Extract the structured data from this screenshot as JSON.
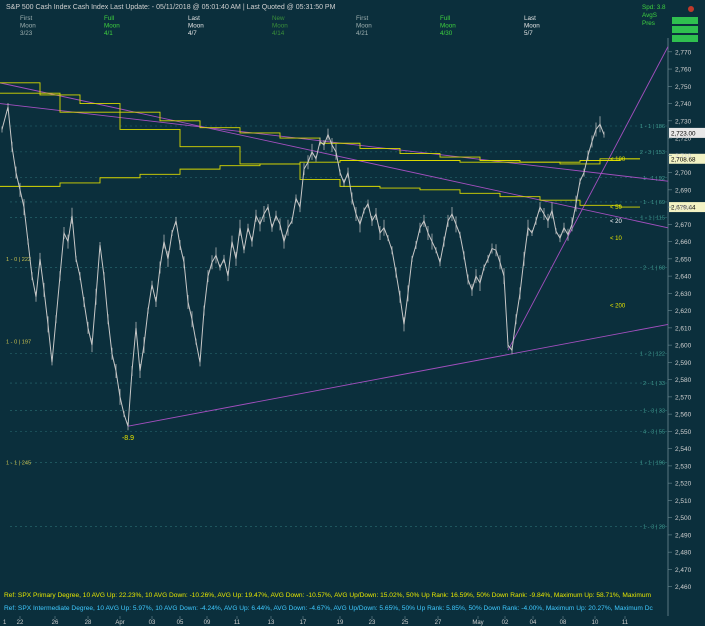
{
  "header": {
    "title": "S&P 500  Cash Index   Cash Index   Last Update: - 05/11/2018 @ 05:01:40 AM | Last Quoted @ 05:31:50 PM",
    "phases": [
      {
        "l1": "First",
        "l2": "Moon",
        "l3": "3/23",
        "c": "#9fb0b0"
      },
      {
        "l1": "Full",
        "l2": "Moon",
        "l3": "4/1",
        "c": "#3fd23f"
      },
      {
        "l1": "Last",
        "l2": "Moon",
        "l3": "4/7",
        "c": "#e6e6e6"
      },
      {
        "l1": "New",
        "l2": "Moon",
        "l3": "4/14",
        "c": "#3a8f3a"
      },
      {
        "l1": "First",
        "l2": "Moon",
        "l3": "4/21",
        "c": "#9fb0b0"
      },
      {
        "l1": "Full",
        "l2": "Moon",
        "l3": "4/30",
        "c": "#3fd23f"
      },
      {
        "l1": "Last",
        "l2": "Moon",
        "l3": "5/7",
        "c": "#e6e6e6"
      }
    ],
    "right_labels": [
      "Spd: 3.8",
      "AvgS",
      "Pres"
    ]
  },
  "chart_data": {
    "type": "line",
    "title": "S&P 500  Cash Index",
    "ylim": [
      2443,
      2778
    ],
    "y_ticks": [
      2460,
      2470,
      2480,
      2490,
      2500,
      2510,
      2520,
      2530,
      2540,
      2550,
      2560,
      2570,
      2580,
      2590,
      2600,
      2610,
      2620,
      2630,
      2640,
      2650,
      2660,
      2670,
      2680,
      2690,
      2700,
      2710,
      2720,
      2730,
      2740,
      2750,
      2760,
      2770
    ],
    "x_ticks": [
      "22",
      "26",
      "28",
      "Apr",
      "03",
      "05",
      "09",
      "11",
      "13",
      "17",
      "19",
      "23",
      "25",
      "27",
      "May",
      "02",
      "04",
      "08",
      "10",
      "11"
    ],
    "series": [
      {
        "color": "#c8c8c8",
        "points": [
          [
            2,
            2725
          ],
          [
            8,
            2738
          ],
          [
            12,
            2715
          ],
          [
            16,
            2700
          ],
          [
            20,
            2690
          ],
          [
            24,
            2680
          ],
          [
            28,
            2660
          ],
          [
            32,
            2640
          ],
          [
            36,
            2628
          ],
          [
            40,
            2650
          ],
          [
            44,
            2632
          ],
          [
            48,
            2612
          ],
          [
            52,
            2590
          ],
          [
            56,
            2615
          ],
          [
            60,
            2640
          ],
          [
            64,
            2665
          ],
          [
            68,
            2660
          ],
          [
            72,
            2675
          ],
          [
            76,
            2650
          ],
          [
            80,
            2640
          ],
          [
            84,
            2625
          ],
          [
            88,
            2610
          ],
          [
            92,
            2600
          ],
          [
            96,
            2628
          ],
          [
            100,
            2658
          ],
          [
            104,
            2640
          ],
          [
            108,
            2615
          ],
          [
            112,
            2595
          ],
          [
            116,
            2585
          ],
          [
            120,
            2570
          ],
          [
            124,
            2560
          ],
          [
            128,
            2553
          ],
          [
            132,
            2585
          ],
          [
            136,
            2610
          ],
          [
            140,
            2585
          ],
          [
            144,
            2600
          ],
          [
            148,
            2620
          ],
          [
            152,
            2635
          ],
          [
            156,
            2625
          ],
          [
            160,
            2645
          ],
          [
            164,
            2660
          ],
          [
            168,
            2650
          ],
          [
            172,
            2665
          ],
          [
            176,
            2672
          ],
          [
            180,
            2658
          ],
          [
            184,
            2648
          ],
          [
            188,
            2625
          ],
          [
            192,
            2615
          ],
          [
            196,
            2602
          ],
          [
            200,
            2590
          ],
          [
            204,
            2620
          ],
          [
            208,
            2640
          ],
          [
            212,
            2648
          ],
          [
            216,
            2652
          ],
          [
            220,
            2645
          ],
          [
            224,
            2650
          ],
          [
            228,
            2640
          ],
          [
            232,
            2660
          ],
          [
            236,
            2650
          ],
          [
            240,
            2668
          ],
          [
            244,
            2655
          ],
          [
            248,
            2668
          ],
          [
            252,
            2660
          ],
          [
            256,
            2675
          ],
          [
            260,
            2670
          ],
          [
            264,
            2676
          ],
          [
            268,
            2680
          ],
          [
            272,
            2668
          ],
          [
            276,
            2675
          ],
          [
            280,
            2670
          ],
          [
            284,
            2660
          ],
          [
            288,
            2668
          ],
          [
            292,
            2672
          ],
          [
            296,
            2685
          ],
          [
            300,
            2680
          ],
          [
            304,
            2702
          ],
          [
            308,
            2706
          ],
          [
            312,
            2712
          ],
          [
            316,
            2708
          ],
          [
            320,
            2718
          ],
          [
            324,
            2716
          ],
          [
            328,
            2722
          ],
          [
            332,
            2716
          ],
          [
            336,
            2712
          ],
          [
            340,
            2700
          ],
          [
            344,
            2694
          ],
          [
            348,
            2700
          ],
          [
            352,
            2685
          ],
          [
            356,
            2676
          ],
          [
            360,
            2670
          ],
          [
            364,
            2678
          ],
          [
            368,
            2682
          ],
          [
            372,
            2672
          ],
          [
            376,
            2676
          ],
          [
            380,
            2665
          ],
          [
            384,
            2668
          ],
          [
            388,
            2662
          ],
          [
            392,
            2655
          ],
          [
            396,
            2642
          ],
          [
            400,
            2628
          ],
          [
            404,
            2612
          ],
          [
            408,
            2630
          ],
          [
            412,
            2650
          ],
          [
            416,
            2658
          ],
          [
            420,
            2668
          ],
          [
            424,
            2672
          ],
          [
            428,
            2665
          ],
          [
            432,
            2660
          ],
          [
            436,
            2655
          ],
          [
            440,
            2648
          ],
          [
            444,
            2660
          ],
          [
            448,
            2672
          ],
          [
            452,
            2676
          ],
          [
            456,
            2670
          ],
          [
            460,
            2664
          ],
          [
            464,
            2652
          ],
          [
            468,
            2638
          ],
          [
            472,
            2632
          ],
          [
            476,
            2640
          ],
          [
            480,
            2636
          ],
          [
            484,
            2645
          ],
          [
            488,
            2650
          ],
          [
            492,
            2656
          ],
          [
            496,
            2655
          ],
          [
            500,
            2648
          ],
          [
            504,
            2640
          ],
          [
            508,
            2600
          ],
          [
            512,
            2597
          ],
          [
            516,
            2615
          ],
          [
            520,
            2630
          ],
          [
            524,
            2650
          ],
          [
            528,
            2668
          ],
          [
            532,
            2665
          ],
          [
            536,
            2672
          ],
          [
            540,
            2680
          ],
          [
            544,
            2676
          ],
          [
            548,
            2672
          ],
          [
            552,
            2678
          ],
          [
            556,
            2666
          ],
          [
            560,
            2662
          ],
          [
            564,
            2668
          ],
          [
            568,
            2664
          ],
          [
            572,
            2670
          ],
          [
            576,
            2682
          ],
          [
            580,
            2695
          ],
          [
            584,
            2700
          ],
          [
            588,
            2710
          ],
          [
            592,
            2718
          ],
          [
            596,
            2725
          ],
          [
            600,
            2728
          ],
          [
            604,
            2722
          ]
        ]
      }
    ],
    "wave_labels": [
      {
        "text": "-8.9",
        "day": 128,
        "y": 2545,
        "color": "#e6e600"
      }
    ]
  },
  "ma_labels": [
    {
      "text": "< 100",
      "y": 2708,
      "color": "#e6e600"
    },
    {
      "text": "< 50",
      "y": 2680,
      "color": "#e6e600"
    },
    {
      "text": "< 20",
      "y": 2672,
      "color": "#ffffff"
    },
    {
      "text": "< 10",
      "y": 2662,
      "color": "#e6e600"
    },
    {
      "text": "< 200",
      "y": 2623,
      "color": "#e6e600"
    }
  ],
  "price_boxes": [
    {
      "text": "2,723.00",
      "y": 2723,
      "bg": "#e8e8e8",
      "fg": "#000000"
    },
    {
      "text": "2,708.68",
      "y": 2708,
      "bg": "#f3f3c4",
      "fg": "#000000"
    },
    {
      "text": "2,679.44",
      "y": 2680,
      "bg": "#f3f3c4",
      "fg": "#000000"
    }
  ],
  "fib_labels": [
    {
      "text": "1 - 1 | 186",
      "y": 2727,
      "side": "right"
    },
    {
      "text": "2 - 3 | 153",
      "y": 2712,
      "side": "right"
    },
    {
      "text": "1 - 1 | 92",
      "y": 2697,
      "side": "right"
    },
    {
      "text": "1 - 1 | 69",
      "y": 2683,
      "side": "right"
    },
    {
      "text": "1 - 1 | 115",
      "y": 2674,
      "side": "right"
    },
    {
      "text": "2 - 1 | 68",
      "y": 2645,
      "side": "right"
    },
    {
      "text": "1 - 2 | 122",
      "y": 2595,
      "side": "right"
    },
    {
      "text": "2 - 1 | 33",
      "y": 2578,
      "side": "right"
    },
    {
      "text": "1 - 3 | 33",
      "y": 2562,
      "side": "right"
    },
    {
      "text": "4 - 3 | 55",
      "y": 2550,
      "side": "right"
    },
    {
      "text": "1 - 1 | 196",
      "y": 2532,
      "side": "right"
    },
    {
      "text": "1 - 3 | 28",
      "y": 2495,
      "side": "right"
    },
    {
      "text": "1 - 0 | 222",
      "y": 2650,
      "side": "left"
    },
    {
      "text": "1 - 0 | 197",
      "y": 2602,
      "side": "left"
    },
    {
      "text": "1 - 1 | 245",
      "y": 2532,
      "side": "left"
    }
  ],
  "footer": {
    "line1": "Ref: SPX Primary Degree, 10 AVG Up: 22.23%, 10 AVG Down: -10.26%, AVG Up: 19.47%, AVG Down: -10.57%, AVG Up/Down: 15.02%, 50%  Up Rank: 16.59%, 50% Down Rank: -9.84%, Maximum Up: 58.71%, Maximum",
    "line2": "Ref: SPX Intermediate Degree, 10 AVG Up: 5.97%, 10 AVG Down: -4.24%, AVG Up: 6.44%, AVG Down: -4.67%, AVG Up/Down: 5.65%, 50%  Up Rank: 5.85%, 50% Down Rank: -4.00%, Maximum Up: 20.27%, Maximum Dc",
    "corner": "1"
  },
  "colors": {
    "background": "#0b2f3c",
    "price": "#c8c8c8",
    "ma": "#d9d900",
    "trend": "#a34fbf",
    "fib_line": "#2b6f73",
    "fib_text": "#3f9a8f",
    "axis_text": "#d0d0d0",
    "footer_1": "#e6e600",
    "footer_2": "#3fc9ff"
  }
}
